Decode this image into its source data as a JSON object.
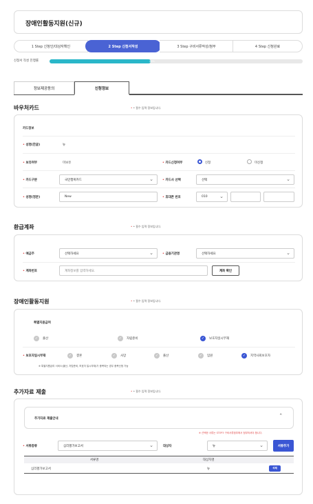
{
  "page": {
    "title": "장애인활동지원(신규)"
  },
  "steps": [
    {
      "label": "1 Step 신청인/대상자확인"
    },
    {
      "label": "2 Step 신청서작성"
    },
    {
      "label": "3 Step 구비서류작성/첨부"
    },
    {
      "label": "4 Step 신청완료"
    }
  ],
  "progress": {
    "label": "신청서 작성 진행률",
    "value": 0.4,
    "text": "40%"
  },
  "tabs": [
    {
      "label": "정보제공동의"
    },
    {
      "label": "신청정보"
    }
  ],
  "voucher": {
    "title": "바우처카드",
    "required_note": "• 필수 입력 정보입니다.",
    "card_info_title": "카드정보",
    "name_kr_label": "성명(한글)",
    "name_kr_value": "뉴",
    "hold_label": "보유여부",
    "hold_value": "미보유",
    "apply_label": "카드신청여부",
    "apply_options": [
      "신청",
      "미신청"
    ],
    "apply_selected": "신청",
    "type_label": "카드구분",
    "type_value": "국민행복카드",
    "company_label": "카드사 선택",
    "company_value": "선택",
    "name_en_label": "성명(영문)",
    "name_en_value": "New",
    "phone_label": "휴대폰 번호",
    "phone_prefix": "010",
    "phone_mid": "",
    "phone_last": ""
  },
  "refund": {
    "title": "환급계좌",
    "required_note": "• 필수 입력 정보입니다.",
    "holder_label": "예금주",
    "holder_value": "선택하세요",
    "bank_label": "금융기관명",
    "bank_value": "선택하세요",
    "account_label": "계좌번호",
    "account_placeholder": "계좌정보를 입력하세요.",
    "confirm_button": "계좌 확인"
  },
  "support": {
    "title": "장애인활동지원",
    "required_note": "• 필수 입력 정보입니다.",
    "special_title": "특별지원급여",
    "special_items": [
      {
        "label": "출산",
        "checked": false
      },
      {
        "label": "자립준비",
        "checked": false
      },
      {
        "label": "보호자일시부재",
        "checked": true
      }
    ],
    "absence_label": "보호자일시부재",
    "absence_items": [
      {
        "label": "결혼",
        "checked": false
      },
      {
        "label": "사망",
        "checked": false
      },
      {
        "label": "출산",
        "checked": false
      },
      {
        "label": "입원",
        "checked": false
      },
      {
        "label": "지역사회보호자",
        "checked": true
      }
    ],
    "footnote": "※ 특별지원급여 서비스(출산, 자립준비, 보호자 일시부재)가 중복되는 경우 중복신청 가능"
  },
  "extra": {
    "title": "추가자료 제출",
    "required_note": "• 필수 입력 정보입니다.",
    "guide_title": "추가자료 제출안내",
    "warning": "※ 선택한 서류는 STEP3 구비서류첨부에서 첨부하셔야 합니다.",
    "doc_type_label": "서류종류",
    "doc_type_value": "심리평가보고서",
    "target_label": "대상자",
    "target_value": "뉴",
    "add_button": "서류추가",
    "table_headers": [
      "서류명",
      "대상자명"
    ],
    "rows": [
      {
        "doc": "심리평가보고서",
        "name": "뉴",
        "action": "삭제"
      }
    ]
  }
}
